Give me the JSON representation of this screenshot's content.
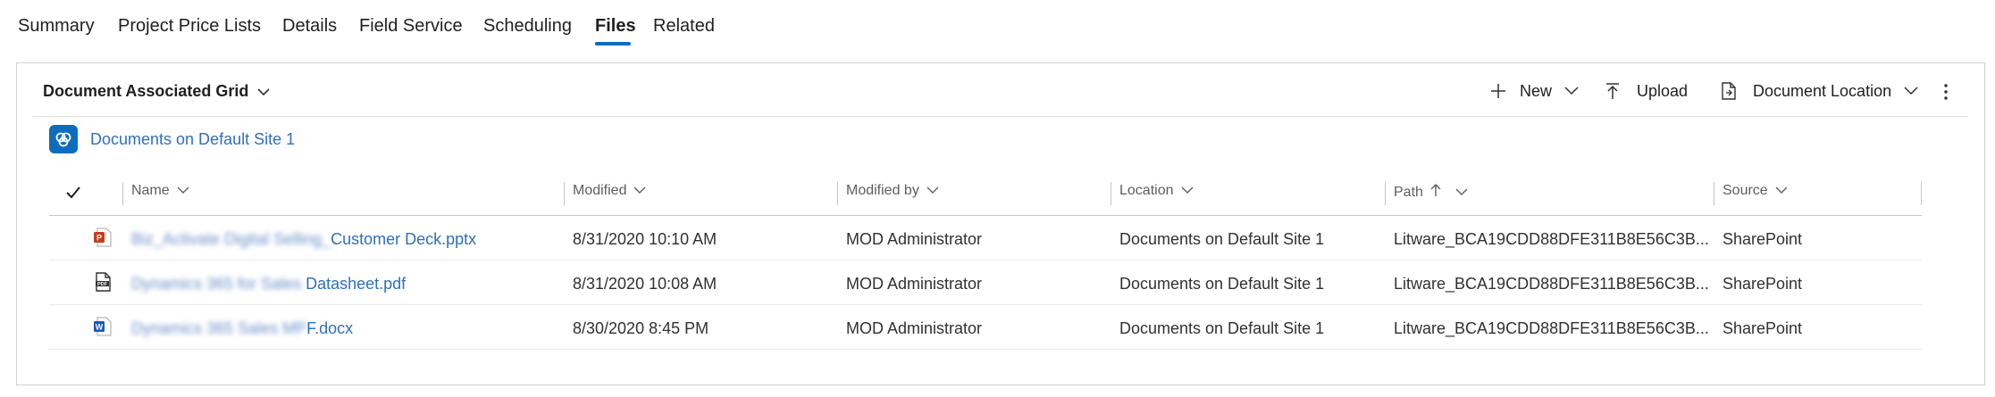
{
  "tabs": [
    {
      "label": "Summary"
    },
    {
      "label": "Project Price Lists"
    },
    {
      "label": "Details"
    },
    {
      "label": "Field Service"
    },
    {
      "label": "Scheduling"
    },
    {
      "label": "Files"
    },
    {
      "label": "Related"
    }
  ],
  "active_tab": "Files",
  "grid": {
    "title": "Document Associated Grid",
    "commands": {
      "new": "New",
      "upload": "Upload",
      "document_location": "Document Location"
    },
    "site_link": "Documents on Default Site 1"
  },
  "table": {
    "columns": [
      "Name",
      "Modified",
      "Modified by",
      "Location",
      "Path",
      "Source"
    ],
    "sorted_column": "Path",
    "rows": [
      {
        "name_hidden": "Biz_Activate Digital Selling_",
        "name_visible": "Customer Deck.pptx",
        "file_type": "pptx",
        "modified": "8/31/2020 10:10 AM",
        "modified_by": "MOD Administrator",
        "location": "Documents on Default Site 1",
        "path": "Litware_BCA19CDD88DFE311B8E56C3B...",
        "source": "SharePoint"
      },
      {
        "name_hidden": "Dynamics 365 for Sales ",
        "name_visible": "Datasheet.pdf",
        "file_type": "pdf",
        "modified": "8/31/2020 10:08 AM",
        "modified_by": "MOD Administrator",
        "location": "Documents on Default Site 1",
        "path": "Litware_BCA19CDD88DFE311B8E56C3B...",
        "source": "SharePoint"
      },
      {
        "name_hidden": "Dynamics 365 Sales MP",
        "name_visible": "F.docx",
        "file_type": "docx",
        "modified": "8/30/2020 8:45 PM",
        "modified_by": "MOD Administrator",
        "location": "Documents on Default Site 1",
        "path": "Litware_BCA19CDD88DFE311B8E56C3B...",
        "source": "SharePoint"
      }
    ]
  },
  "colors": {
    "accent": "#0f6cbd",
    "link": "#2f6fbd",
    "pptx": "#c43e1c",
    "docx": "#185abd"
  }
}
